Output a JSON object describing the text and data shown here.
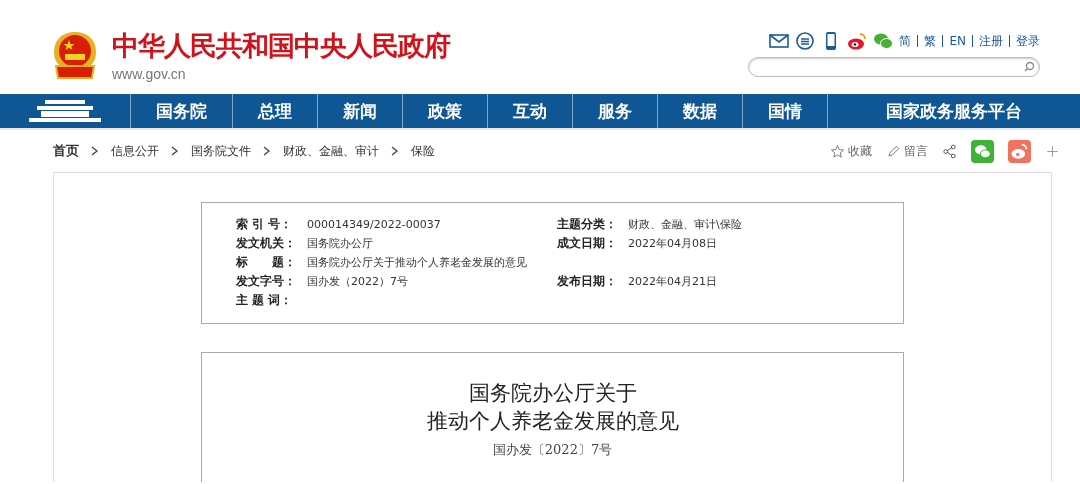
{
  "header": {
    "title": "中华人民共和国中央人民政府",
    "site_url": "www.gov.cn",
    "lang_links": [
      "简",
      "繁",
      "EN",
      "注册",
      "登录"
    ]
  },
  "nav": {
    "items": [
      {
        "label": "国务院"
      },
      {
        "label": "总理"
      },
      {
        "label": "新闻"
      },
      {
        "label": "政策"
      },
      {
        "label": "互动"
      },
      {
        "label": "服务"
      },
      {
        "label": "数据"
      },
      {
        "label": "国情"
      },
      {
        "label": "国家政务服务平台"
      }
    ]
  },
  "breadcrumb": [
    "首页",
    "信息公开",
    "国务院文件",
    "财政、金融、审计",
    "保险"
  ],
  "actions": [
    {
      "kind": "star",
      "label": "收藏"
    },
    {
      "kind": "pen",
      "label": "留言"
    },
    {
      "kind": "share"
    },
    {
      "kind": "wechat"
    },
    {
      "kind": "weibo"
    },
    {
      "kind": "plus"
    }
  ],
  "meta": {
    "rows": [
      {
        "fields": [
          {
            "label": "索 引 号：",
            "value": "000014349/2022-00037"
          },
          {
            "label": "主题分类：",
            "value": "财政、金融、审计\\保险"
          }
        ]
      },
      {
        "fields": [
          {
            "label": "发文机关：",
            "value": "国务院办公厅"
          },
          {
            "label": "成文日期：",
            "value": "2022年04月08日"
          }
        ]
      },
      {
        "fields": [
          {
            "label": "标　　题：",
            "value": "国务院办公厅关于推动个人养老金发展的意见"
          }
        ]
      },
      {
        "fields": [
          {
            "label": "发文字号：",
            "value": "国办发（2022）7号"
          },
          {
            "label": "发布日期：",
            "value": "2022年04月21日"
          }
        ]
      },
      {
        "fields": [
          {
            "label": "主 题 词："
          }
        ]
      }
    ]
  },
  "document": {
    "title_lines": [
      "国务院办公厅关于",
      "推动个人养老金发展的意见"
    ],
    "doc_number": "国办发〔2022〕7号"
  }
}
